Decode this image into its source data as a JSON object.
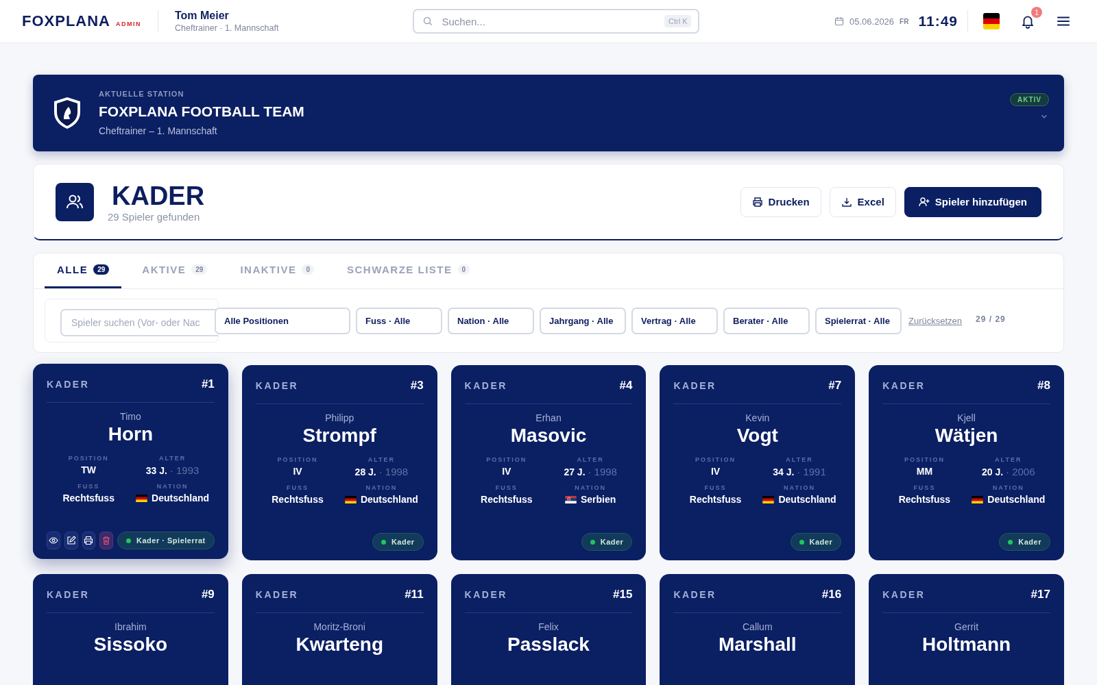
{
  "header": {
    "logo": "FOXPLANA",
    "role_badge": "ADMIN",
    "user": {
      "name": "Tom Meier",
      "role": "Cheftrainer · 1. Mannschaft"
    },
    "search": {
      "placeholder": "Suchen...",
      "shortcut": "Ctrl K"
    },
    "date": "05.06.2026",
    "weekday": "FR",
    "time": "11:49",
    "notifications": "1"
  },
  "station": {
    "eyebrow": "AKTUELLE STATION",
    "title": "FOXPLANA FOOTBALL TEAM",
    "subtitle": "Cheftrainer – 1. Mannschaft",
    "status": "AKTIV"
  },
  "page": {
    "title": "KADER",
    "count": "29 Spieler gefunden",
    "buttons": [
      {
        "kind": "print",
        "label": "Drucken"
      },
      {
        "kind": "download",
        "label": "Excel"
      },
      {
        "kind": "add",
        "label": "Spieler hinzufügen"
      }
    ]
  },
  "tabs": [
    {
      "label": "ALLE",
      "count": "29",
      "selected": true
    },
    {
      "label": "AKTIVE",
      "count": "29",
      "selected": false
    },
    {
      "label": "INAKTIVE",
      "count": "0",
      "selected": false
    },
    {
      "label": "SCHWARZE LISTE",
      "count": "0",
      "selected": false
    }
  ],
  "filters": {
    "search_placeholder": "Spieler suchen (Vor- oder Nac",
    "selects": [
      "Alle Positionen",
      "Fuss · Alle",
      "Nation · Alle",
      "Jahrgang · Alle",
      "Vertrag · Alle",
      "Berater · Alle",
      "Spielerrat · Alle"
    ],
    "reset": "Zurücksetzen",
    "result": "29 / 29"
  },
  "players": [
    {
      "group": "KADER",
      "number": "#1",
      "first": "Timo",
      "last": "Horn",
      "position_label": "POSITION",
      "position": "TW",
      "age_label": "ALTER",
      "age": "33 J.",
      "year": "· 1993",
      "foot_label": "FUSS",
      "foot": "Rechtsfuss",
      "nation_label": "NATION",
      "nation": {
        "kind": "de",
        "name": "Deutschland"
      },
      "status": "Kader · Spielerrat",
      "hovered": true
    },
    {
      "group": "KADER",
      "number": "#3",
      "first": "Philipp",
      "last": "Strompf",
      "position_label": "POSITION",
      "position": "IV",
      "age_label": "ALTER",
      "age": "28 J.",
      "year": "· 1998",
      "foot_label": "FUSS",
      "foot": "Rechtsfuss",
      "nation_label": "NATION",
      "nation": {
        "kind": "de",
        "name": "Deutschland"
      },
      "status": "Kader",
      "hovered": false
    },
    {
      "group": "KADER",
      "number": "#4",
      "first": "Erhan",
      "last": "Masovic",
      "position_label": "POSITION",
      "position": "IV",
      "age_label": "ALTER",
      "age": "27 J.",
      "year": "· 1998",
      "foot_label": "FUSS",
      "foot": "Rechtsfuss",
      "nation_label": "NATION",
      "nation": {
        "kind": "rs",
        "name": "Serbien"
      },
      "status": "Kader",
      "hovered": false
    },
    {
      "group": "KADER",
      "number": "#7",
      "first": "Kevin",
      "last": "Vogt",
      "position_label": "POSITION",
      "position": "IV",
      "age_label": "ALTER",
      "age": "34 J.",
      "year": "· 1991",
      "foot_label": "FUSS",
      "foot": "Rechtsfuss",
      "nation_label": "NATION",
      "nation": {
        "kind": "de",
        "name": "Deutschland"
      },
      "status": "Kader",
      "hovered": false
    },
    {
      "group": "KADER",
      "number": "#8",
      "first": "Kjell",
      "last": "Wätjen",
      "position_label": "POSITION",
      "position": "MM",
      "age_label": "ALTER",
      "age": "20 J.",
      "year": "· 2006",
      "foot_label": "FUSS",
      "foot": "Rechtsfuss",
      "nation_label": "NATION",
      "nation": {
        "kind": "de",
        "name": "Deutschland"
      },
      "status": "Kader",
      "hovered": false
    },
    {
      "group": "KADER",
      "number": "#9",
      "first": "Ibrahim",
      "last": "Sissoko"
    },
    {
      "group": "KADER",
      "number": "#11",
      "first": "Moritz-Broni",
      "last": "Kwarteng"
    },
    {
      "group": "KADER",
      "number": "#15",
      "first": "Felix",
      "last": "Passlack"
    },
    {
      "group": "KADER",
      "number": "#16",
      "first": "Callum",
      "last": "Marshall"
    },
    {
      "group": "KADER",
      "number": "#17",
      "first": "Gerrit",
      "last": "Holtmann"
    }
  ]
}
